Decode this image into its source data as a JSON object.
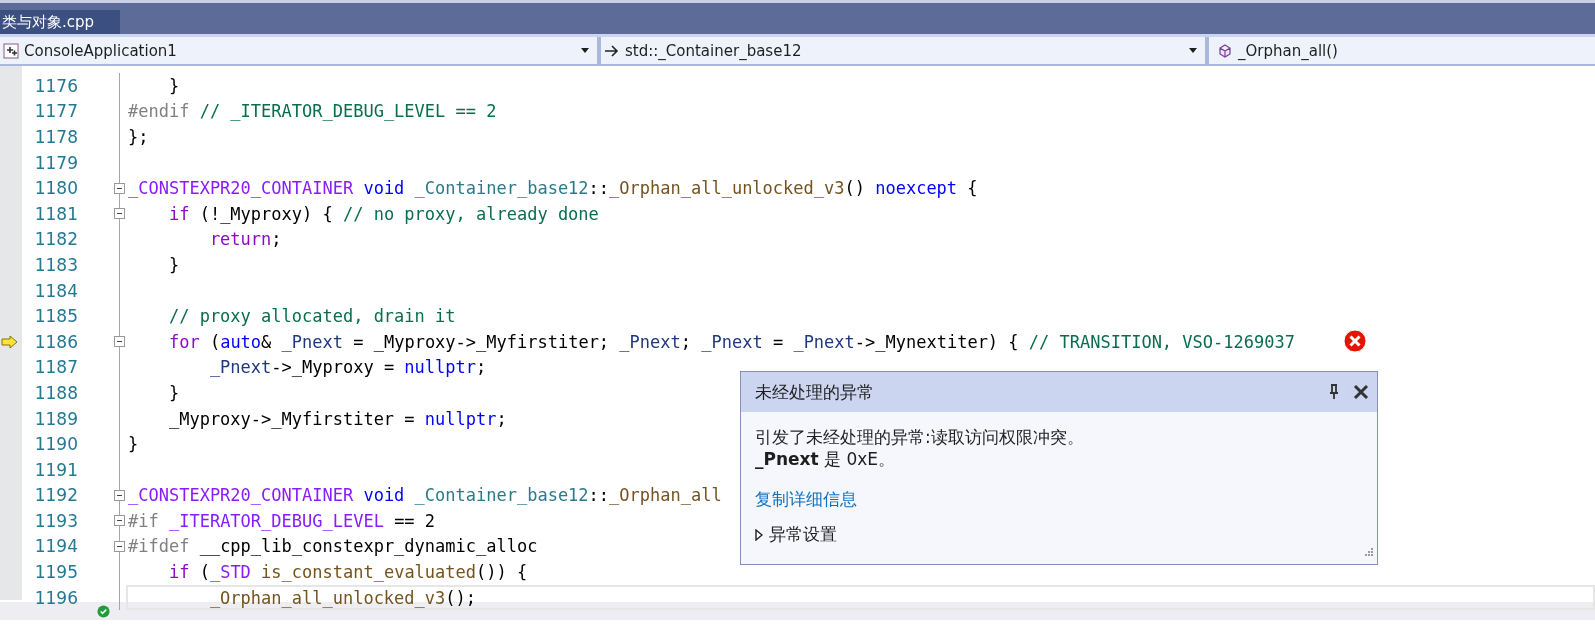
{
  "file_tab": {
    "label": "类与对象.cpp",
    "selected": true
  },
  "navigation_bar": [
    {
      "kind": "project",
      "label": "ConsoleApplication1"
    },
    {
      "kind": "scope",
      "label": "std::_Container_base12"
    },
    {
      "kind": "member",
      "label": "_Orphan_all()"
    }
  ],
  "code_lines": [
    {
      "number": "1176",
      "fold_marker": false,
      "current_statement": false,
      "cursor": false,
      "tokens": [
        {
          "kind": "plain",
          "text": "    }"
        }
      ]
    },
    {
      "number": "1177",
      "fold_marker": false,
      "current_statement": false,
      "cursor": false,
      "tokens": [
        {
          "kind": "preprocessor",
          "text": "#endif"
        },
        {
          "kind": "comment",
          "text": " // _ITERATOR_DEBUG_LEVEL == 2"
        }
      ]
    },
    {
      "number": "1178",
      "fold_marker": false,
      "current_statement": false,
      "cursor": false,
      "tokens": [
        {
          "kind": "plain",
          "text": "};"
        }
      ]
    },
    {
      "number": "1179",
      "fold_marker": false,
      "current_statement": false,
      "cursor": false
    },
    {
      "number": "1180",
      "fold_marker": true,
      "current_statement": false,
      "cursor": false,
      "tokens": [
        {
          "kind": "macro",
          "text": "_CONSTEXPR20_CONTAINER"
        },
        {
          "kind": "keyword",
          "text": " void"
        },
        {
          "kind": "type",
          "text": " _Container_base12"
        },
        {
          "kind": "plain",
          "text": "::"
        },
        {
          "kind": "function",
          "text": "_Orphan_all_unlocked_v3"
        },
        {
          "kind": "plain",
          "text": "() "
        },
        {
          "kind": "keyword",
          "text": "noexcept"
        },
        {
          "kind": "plain",
          "text": " {"
        }
      ]
    },
    {
      "number": "1181",
      "fold_marker": true,
      "current_statement": false,
      "cursor": false,
      "tokens": [
        {
          "kind": "control",
          "text": "    if"
        },
        {
          "kind": "plain",
          "text": " (!_Myproxy) { "
        },
        {
          "kind": "comment",
          "text": "// no proxy, already done"
        }
      ]
    },
    {
      "number": "1182",
      "fold_marker": false,
      "current_statement": false,
      "cursor": false,
      "tokens": [
        {
          "kind": "control",
          "text": "        return"
        },
        {
          "kind": "plain",
          "text": ";"
        }
      ]
    },
    {
      "number": "1183",
      "fold_marker": false,
      "current_statement": false,
      "cursor": false,
      "tokens": [
        {
          "kind": "plain",
          "text": "    }"
        }
      ]
    },
    {
      "number": "1184",
      "fold_marker": false,
      "current_statement": false,
      "cursor": false
    },
    {
      "number": "1185",
      "fold_marker": false,
      "current_statement": false,
      "cursor": false,
      "tokens": [
        {
          "kind": "comment",
          "text": "    // proxy allocated, drain it"
        }
      ]
    },
    {
      "number": "1186",
      "fold_marker": true,
      "current_statement": true,
      "cursor": false,
      "tokens": [
        {
          "kind": "control",
          "text": "    for"
        },
        {
          "kind": "plain",
          "text": " ("
        },
        {
          "kind": "keyword",
          "text": "auto"
        },
        {
          "kind": "plain",
          "text": "& "
        },
        {
          "kind": "local",
          "text": "_Pnext"
        },
        {
          "kind": "plain",
          "text": " = _Myproxy->_Myfirstiter; "
        },
        {
          "kind": "local",
          "text": "_Pnext"
        },
        {
          "kind": "plain",
          "text": "; "
        },
        {
          "kind": "local",
          "text": "_Pnext"
        },
        {
          "kind": "plain",
          "text": " = "
        },
        {
          "kind": "local",
          "text": "_Pnext"
        },
        {
          "kind": "plain",
          "text": "->_Mynextiter) { "
        },
        {
          "kind": "comment",
          "text": "// TRANSITION, VSO-1269037"
        }
      ]
    },
    {
      "number": "1187",
      "fold_marker": false,
      "current_statement": false,
      "cursor": false,
      "tokens": [
        {
          "kind": "local",
          "text": "        _Pnext"
        },
        {
          "kind": "plain",
          "text": "->_Myproxy = "
        },
        {
          "kind": "keyword",
          "text": "nullptr"
        },
        {
          "kind": "plain",
          "text": ";"
        }
      ]
    },
    {
      "number": "1188",
      "fold_marker": false,
      "current_statement": false,
      "cursor": false,
      "tokens": [
        {
          "kind": "plain",
          "text": "    }"
        }
      ]
    },
    {
      "number": "1189",
      "fold_marker": false,
      "current_statement": false,
      "cursor": false,
      "tokens": [
        {
          "kind": "plain",
          "text": "    _Myproxy->_Myfirstiter = "
        },
        {
          "kind": "keyword",
          "text": "nullptr"
        },
        {
          "kind": "plain",
          "text": ";"
        }
      ]
    },
    {
      "number": "1190",
      "fold_marker": false,
      "current_statement": false,
      "cursor": false,
      "tokens": [
        {
          "kind": "plain",
          "text": "}"
        }
      ]
    },
    {
      "number": "1191",
      "fold_marker": false,
      "current_statement": false,
      "cursor": false
    },
    {
      "number": "1192",
      "fold_marker": true,
      "current_statement": false,
      "cursor": false,
      "tokens": [
        {
          "kind": "macro",
          "text": "_CONSTEXPR20_CONTAINER"
        },
        {
          "kind": "keyword",
          "text": " void"
        },
        {
          "kind": "type",
          "text": " _Container_base12"
        },
        {
          "kind": "plain",
          "text": "::"
        },
        {
          "kind": "function",
          "text": "_Orphan_all"
        }
      ]
    },
    {
      "number": "1193",
      "fold_marker": true,
      "current_statement": false,
      "cursor": false,
      "tokens": [
        {
          "kind": "preprocessor",
          "text": "#if"
        },
        {
          "kind": "macro",
          "text": " _ITERATOR_DEBUG_LEVEL"
        },
        {
          "kind": "plain",
          "text": " == 2"
        }
      ]
    },
    {
      "number": "1194",
      "fold_marker": true,
      "current_statement": false,
      "cursor": false,
      "tokens": [
        {
          "kind": "preprocessor",
          "text": "#ifdef"
        },
        {
          "kind": "plain",
          "text": " __cpp_lib_constexpr_dynamic_alloc"
        }
      ]
    },
    {
      "number": "1195",
      "fold_marker": false,
      "current_statement": false,
      "cursor": false,
      "tokens": [
        {
          "kind": "control",
          "text": "    if"
        },
        {
          "kind": "plain",
          "text": " ("
        },
        {
          "kind": "macro",
          "text": "_STD"
        },
        {
          "kind": "function",
          "text": " is_constant_evaluated"
        },
        {
          "kind": "plain",
          "text": "()) {"
        }
      ]
    },
    {
      "number": "1196",
      "fold_marker": false,
      "current_statement": false,
      "cursor": true,
      "tokens": [
        {
          "kind": "function",
          "text": "        _Orphan_all_unlocked_v3"
        },
        {
          "kind": "plain",
          "text": "();"
        }
      ]
    }
  ],
  "exception_popup": {
    "title": "未经处理的异常",
    "message": "引发了未经处理的异常:读取访问权限冲突。",
    "detail": "**_Pnext** 是 0xE。",
    "link": "复制详细信息",
    "settings": {
      "label": "异常设置",
      "expanded": false
    }
  }
}
